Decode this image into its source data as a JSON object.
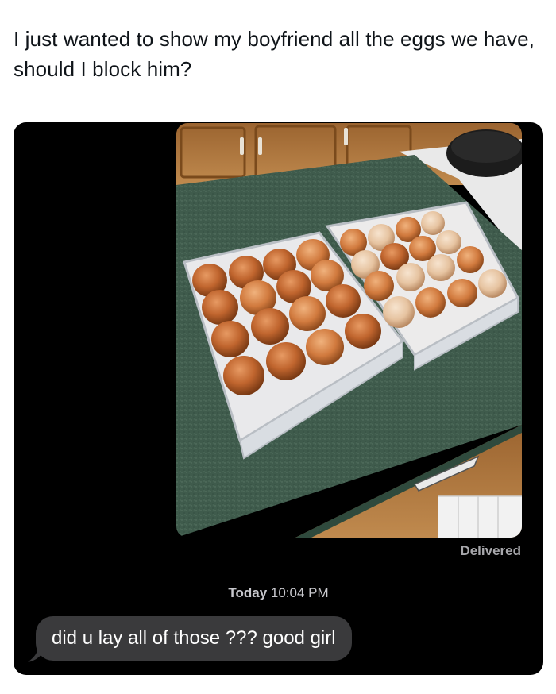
{
  "post": {
    "caption": "I just wanted to show my boyfriend all the eggs we have, should I block him?"
  },
  "messages": {
    "status": "Delivered",
    "timestamp_day": "Today",
    "timestamp_time": "10:04 PM",
    "received_text": "did u lay all of those ??? good girl"
  },
  "colors": {
    "screen_background": "#000000",
    "bubble_background": "#3a3a3c",
    "countertop": "#3d5a4a",
    "cabinet": "#b7864a"
  },
  "photo": {
    "egg_trays": 2,
    "description_icon": "photo-egg-trays"
  }
}
